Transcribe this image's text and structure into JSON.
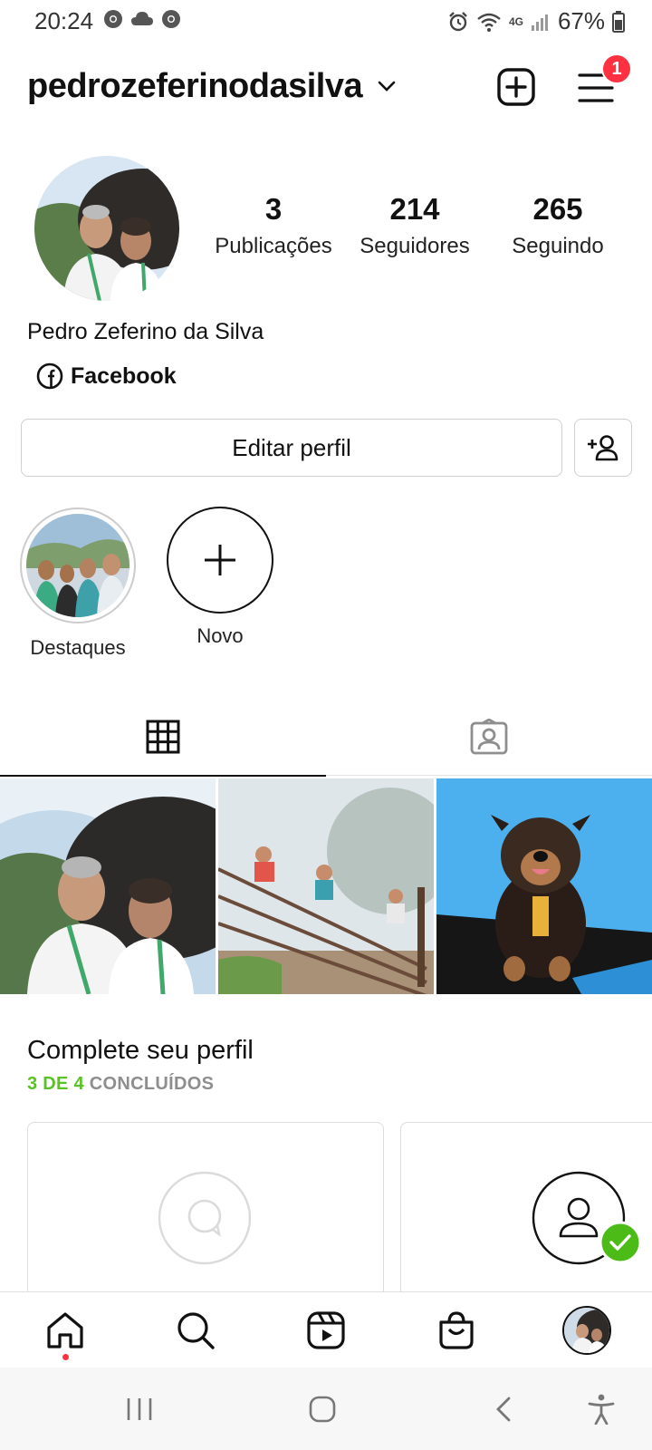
{
  "status_bar": {
    "time": "20:24",
    "battery": "67%",
    "network": "4G",
    "left_icons": [
      "chrome-icon",
      "cloud-icon",
      "chrome-icon"
    ],
    "right_icons": [
      "alarm-icon",
      "wifi-icon",
      "signal-icon",
      "battery-icon"
    ]
  },
  "header": {
    "username": "pedrozeferinodasilva",
    "notification_count": "1"
  },
  "profile": {
    "full_name": "Pedro Zeferino da Silva",
    "link_label": "Facebook",
    "stats": [
      {
        "value": "3",
        "label": "Publicações"
      },
      {
        "value": "214",
        "label": "Seguidores"
      },
      {
        "value": "265",
        "label": "Seguindo"
      }
    ]
  },
  "actions": {
    "edit_label": "Editar perfil"
  },
  "highlights": [
    {
      "label": "Destaques"
    },
    {
      "label": "Novo"
    }
  ],
  "tabs": [
    "grid-icon",
    "tagged-icon"
  ],
  "complete_profile": {
    "title": "Complete seu perfil",
    "done": "3 DE 4",
    "suffix": " CONCLUÍDOS"
  },
  "bottom_nav": [
    "home-icon",
    "search-icon",
    "reels-icon",
    "shop-icon",
    "profile-avatar"
  ],
  "colors": {
    "badge": "#ff3040",
    "success_green": "#58c322",
    "check_green": "#4cbb17"
  }
}
